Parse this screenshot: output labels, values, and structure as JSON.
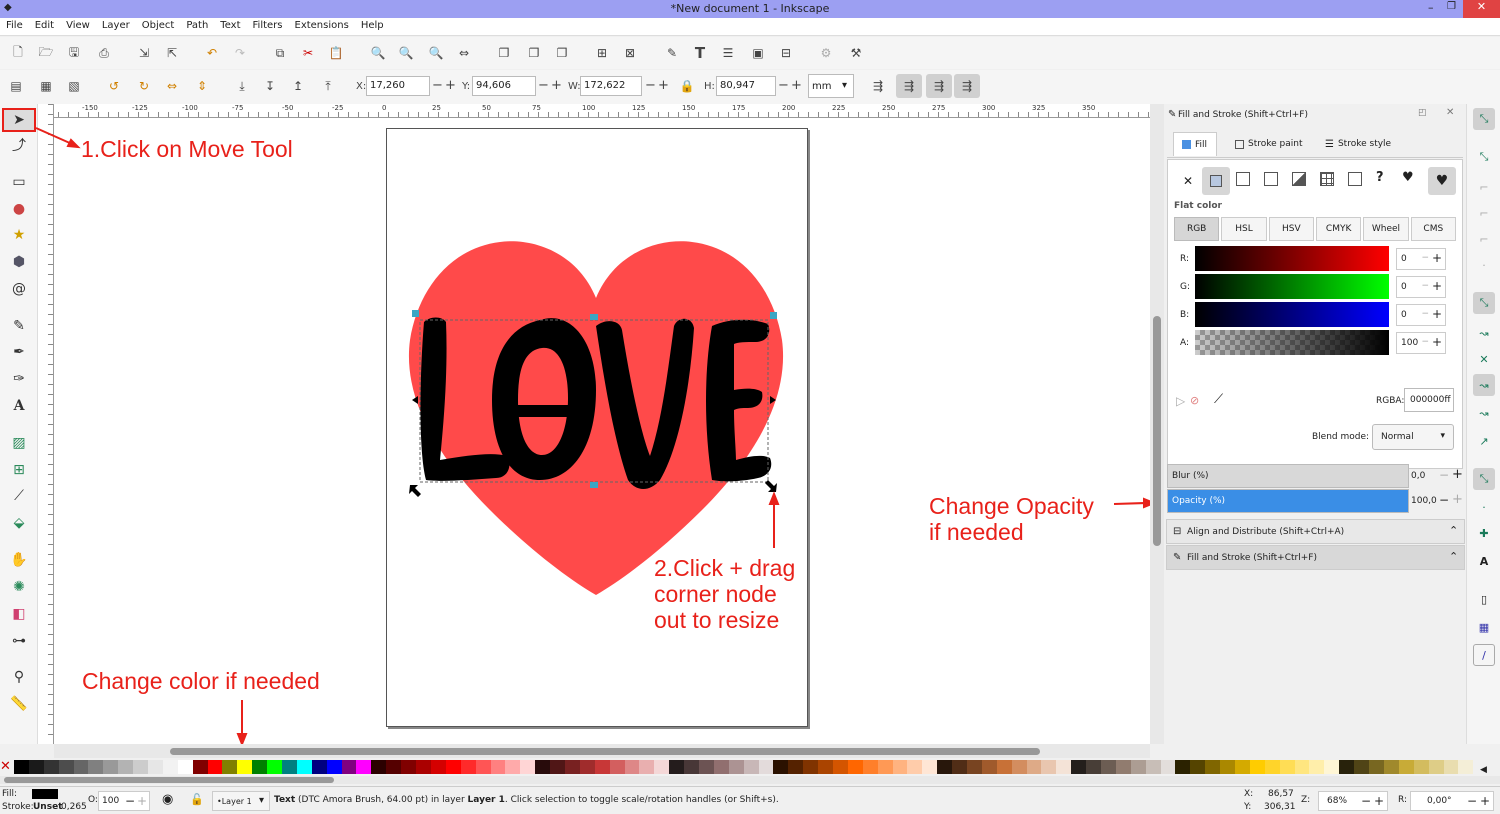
{
  "window": {
    "title": "*New document 1 - Inkscape"
  },
  "menu": [
    "File",
    "Edit",
    "View",
    "Layer",
    "Object",
    "Path",
    "Text",
    "Filters",
    "Extensions",
    "Help"
  ],
  "toolbar": {
    "x_label": "X:",
    "x_value": "17,260",
    "y_label": "Y:",
    "y_value": "94,606",
    "w_label": "W:",
    "w_value": "172,622",
    "h_label": "H:",
    "h_value": "80,947",
    "unit": "mm"
  },
  "ruler_ticks": [
    "-150",
    "-125",
    "-100",
    "-75",
    "-50",
    "-25",
    "0",
    "25",
    "50",
    "75",
    "100",
    "125",
    "150",
    "175",
    "200",
    "225",
    "250",
    "275",
    "300",
    "325",
    "350"
  ],
  "canvas": {
    "text": "LOVE",
    "heart_color": "#ff4a4a"
  },
  "panel": {
    "title": "Fill and Stroke (Shift+Ctrl+F)",
    "tabs": [
      "Fill",
      "Stroke paint",
      "Stroke style"
    ],
    "flat_color_label": "Flat color",
    "modes": [
      "RGB",
      "HSL",
      "HSV",
      "CMYK",
      "Wheel",
      "CMS"
    ],
    "channels": [
      {
        "label": "R:",
        "value": "0"
      },
      {
        "label": "G:",
        "value": "0"
      },
      {
        "label": "B:",
        "value": "0"
      },
      {
        "label": "A:",
        "value": "100"
      }
    ],
    "rgba_label": "RGBA:",
    "rgba_value": "000000ff",
    "blend_label": "Blend mode:",
    "blend_value": "Normal",
    "blur_label": "Blur (%)",
    "blur_value": "0,0",
    "opacity_label": "Opacity (%)",
    "opacity_value": "100,0",
    "opacity_fraction": 1.0,
    "dock_items": [
      "Align and Distribute (Shift+Ctrl+A)",
      "Fill and Stroke (Shift+Ctrl+F)"
    ]
  },
  "annotations": {
    "move_tool": "1.Click on Move Tool",
    "resize": [
      "2.Click + drag",
      "corner node",
      "out to resize"
    ],
    "opacity": [
      "Change Opacity",
      "if needed"
    ],
    "color": "Change color if needed"
  },
  "status": {
    "fill_label": "Fill:",
    "stroke_label": "Stroke:",
    "stroke_value": "Unset",
    "stroke_width": "0,265",
    "opacity_label": "O:",
    "opacity_value": "100",
    "layer": "•Layer 1",
    "message_bold": "Text",
    "message": "(DTC Amora Brush, 64.00 pt) in layer",
    "message_layer": "Layer 1",
    "message_tail": ". Click selection to toggle scale/rotation handles (or Shift+s).",
    "x_label": "X:",
    "x_value": "86,57",
    "y_label": "Y:",
    "y_value": "306,31",
    "zoom_label": "Z:",
    "zoom_value": "68%",
    "rotate_label": "R:",
    "rotate_value": "0,00°"
  },
  "palette": [
    "#000000",
    "#1a1a1a",
    "#333333",
    "#4d4d4d",
    "#666666",
    "#808080",
    "#999999",
    "#b3b3b3",
    "#cccccc",
    "#e6e6e6",
    "#f2f2f2",
    "#ffffff",
    "#800000",
    "#ff0000",
    "#808000",
    "#ffff00",
    "#008000",
    "#00ff00",
    "#008080",
    "#00ffff",
    "#000080",
    "#0000ff",
    "#800080",
    "#ff00ff",
    "#2b0000",
    "#550000",
    "#800000",
    "#aa0000",
    "#d40000",
    "#ff0000",
    "#ff2a2a",
    "#ff5555",
    "#ff8080",
    "#ffaaaa",
    "#ffd5d5",
    "#280b0b",
    "#501616",
    "#782121",
    "#a02c2c",
    "#c83737",
    "#d35f5f",
    "#de8787",
    "#e9afaf",
    "#f4d7d7",
    "#241c1c",
    "#483737",
    "#6c5353",
    "#916f6f",
    "#ac9393",
    "#c8b7b7",
    "#e3dbdb",
    "#2b1100",
    "#552200",
    "#803300",
    "#aa4400",
    "#d45500",
    "#ff6600",
    "#ff7f2a",
    "#ff9955",
    "#ffb380",
    "#ffccaa",
    "#ffe6d5",
    "#28170b",
    "#502d16",
    "#784421",
    "#a05a2c",
    "#c87137",
    "#d38d5f",
    "#deaa87",
    "#e9c6af",
    "#f4e3d7",
    "#241f1c",
    "#483e37",
    "#6c5d53",
    "#917c6f",
    "#ac9d93",
    "#c8beb7",
    "#e3dedb",
    "#2b2200",
    "#554400",
    "#806600",
    "#aa8800",
    "#d4aa00",
    "#ffcc00",
    "#ffd42a",
    "#ffdd55",
    "#ffe680",
    "#ffeeaa",
    "#fff6d5",
    "#28220b",
    "#504416",
    "#786721",
    "#a0892c",
    "#c8ab37",
    "#d3bc5f",
    "#decd87",
    "#e9ddaf",
    "#f4eed7"
  ]
}
